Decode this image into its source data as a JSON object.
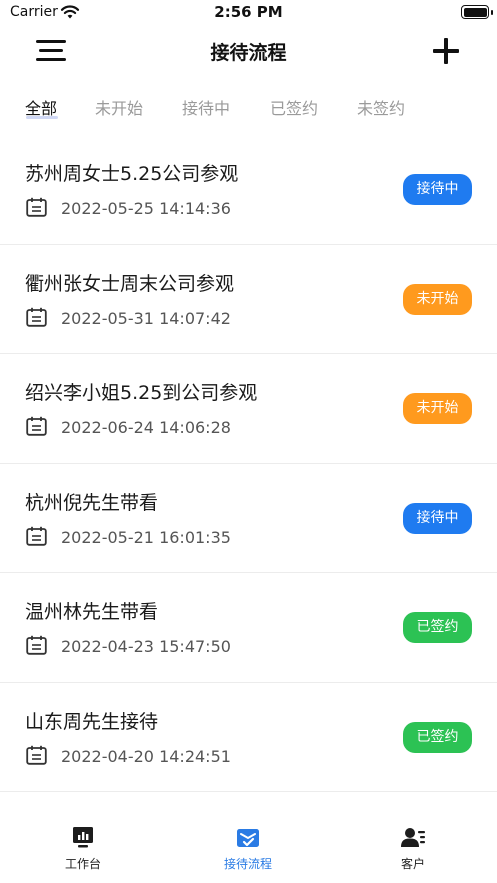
{
  "status_bar": {
    "carrier": "Carrier",
    "time": "2:56 PM"
  },
  "nav": {
    "title": "接待流程",
    "menu_icon": "hamburger-menu-icon",
    "add_icon": "plus-icon"
  },
  "tabs": [
    {
      "label": "全部",
      "active": true
    },
    {
      "label": "未开始",
      "active": false
    },
    {
      "label": "接待中",
      "active": false
    },
    {
      "label": "已签约",
      "active": false
    },
    {
      "label": "未签约",
      "active": false
    }
  ],
  "records": [
    {
      "title": "苏州周女士5.25公司参观",
      "time": "2022-05-25 14:14:36",
      "status": "接待中"
    },
    {
      "title": "衢州张女士周末公司参观",
      "time": "2022-05-31 14:07:42",
      "status": "未开始"
    },
    {
      "title": "绍兴李小姐5.25到公司参观",
      "time": "2022-06-24 14:06:28",
      "status": "未开始"
    },
    {
      "title": "杭州倪先生带看",
      "time": "2022-05-21 16:01:35",
      "status": "接待中"
    },
    {
      "title": "温州林先生带看",
      "time": "2022-04-23 15:47:50",
      "status": "已签约"
    },
    {
      "title": "山东周先生接待",
      "time": "2022-04-20 14:24:51",
      "status": "已签约"
    }
  ],
  "status_colors": {
    "接待中": "#1f7bf0",
    "未开始": "#ff9a1e",
    "已签约": "#2cc254"
  },
  "tabbar": [
    {
      "label": "工作台",
      "icon": "dashboard-monitor-icon",
      "active": false
    },
    {
      "label": "接待流程",
      "icon": "reception-flow-icon",
      "active": true
    },
    {
      "label": "客户",
      "icon": "customer-list-icon",
      "active": false
    }
  ],
  "accent_color": "#2a7be4"
}
